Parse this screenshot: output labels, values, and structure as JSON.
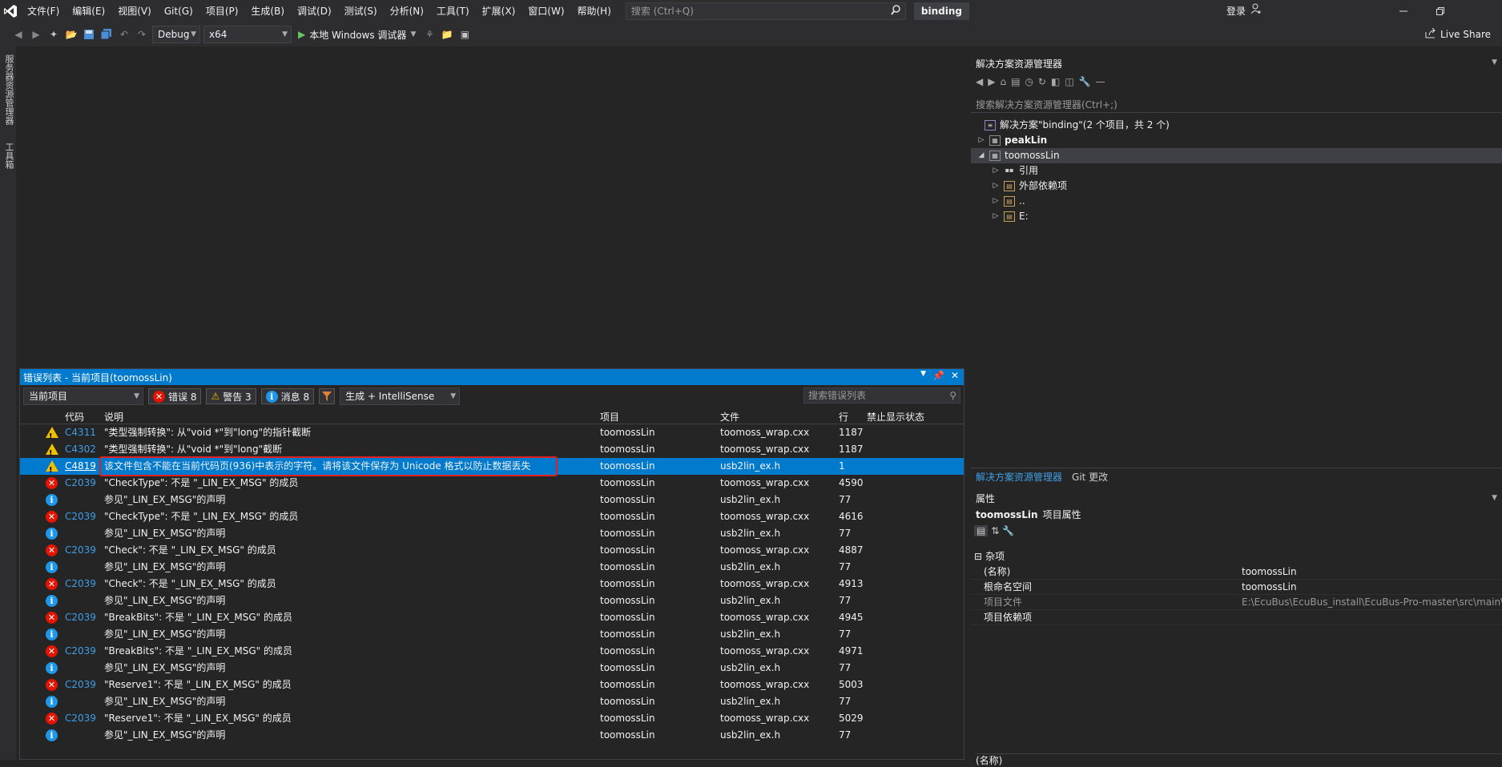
{
  "menubar": {
    "items": [
      "文件(F)",
      "编辑(E)",
      "视图(V)",
      "Git(G)",
      "项目(P)",
      "生成(B)",
      "调试(D)",
      "测试(S)",
      "分析(N)",
      "工具(T)",
      "扩展(X)",
      "窗口(W)",
      "帮助(H)"
    ],
    "search_placeholder": "搜索 (Ctrl+Q)",
    "solution_title": "binding",
    "login": "登录"
  },
  "toolbar": {
    "config": "Debug",
    "platform": "x64",
    "run_label": "本地 Windows 调试器",
    "live_share": "Live Share"
  },
  "left_strip": {
    "tab1": "服务器资源管理器",
    "tab2": "工具箱"
  },
  "error_list": {
    "title": "错误列表 - 当前项目(toomossLin)",
    "scope": "当前项目",
    "errors_label": "错误 8",
    "warnings_label": "警告 3",
    "messages_label": "消息 8",
    "build_filter": "生成 + IntelliSense",
    "search_placeholder": "搜索错误列表",
    "columns": [
      "代码",
      "说明",
      "项目",
      "文件",
      "行",
      "禁止显示状态"
    ],
    "rows": [
      {
        "type": "warning",
        "code": "C4311",
        "desc": "\"类型强制转换\": 从\"void *\"到\"long\"的指针截断",
        "project": "toomossLin",
        "file": "toomoss_wrap.cxx",
        "line": "1187"
      },
      {
        "type": "warning",
        "code": "C4302",
        "desc": "\"类型强制转换\": 从\"void *\"到\"long\"截断",
        "project": "toomossLin",
        "file": "toomoss_wrap.cxx",
        "line": "1187"
      },
      {
        "type": "warning",
        "code": "C4819",
        "desc": "该文件包含不能在当前代码页(936)中表示的字符。请将该文件保存为 Unicode 格式以防止数据丢失",
        "project": "toomossLin",
        "file": "usb2lin_ex.h",
        "line": "1",
        "selected": true
      },
      {
        "type": "error",
        "code": "C2039",
        "desc": "\"CheckType\": 不是 \"_LIN_EX_MSG\" 的成员",
        "project": "toomossLin",
        "file": "toomoss_wrap.cxx",
        "line": "4590"
      },
      {
        "type": "info",
        "code": "",
        "desc": "参见\"_LIN_EX_MSG\"的声明",
        "project": "toomossLin",
        "file": "usb2lin_ex.h",
        "line": "77"
      },
      {
        "type": "error",
        "code": "C2039",
        "desc": "\"CheckType\": 不是 \"_LIN_EX_MSG\" 的成员",
        "project": "toomossLin",
        "file": "toomoss_wrap.cxx",
        "line": "4616"
      },
      {
        "type": "info",
        "code": "",
        "desc": "参见\"_LIN_EX_MSG\"的声明",
        "project": "toomossLin",
        "file": "usb2lin_ex.h",
        "line": "77"
      },
      {
        "type": "error",
        "code": "C2039",
        "desc": "\"Check\": 不是 \"_LIN_EX_MSG\" 的成员",
        "project": "toomossLin",
        "file": "toomoss_wrap.cxx",
        "line": "4887"
      },
      {
        "type": "info",
        "code": "",
        "desc": "参见\"_LIN_EX_MSG\"的声明",
        "project": "toomossLin",
        "file": "usb2lin_ex.h",
        "line": "77"
      },
      {
        "type": "error",
        "code": "C2039",
        "desc": "\"Check\": 不是 \"_LIN_EX_MSG\" 的成员",
        "project": "toomossLin",
        "file": "toomoss_wrap.cxx",
        "line": "4913"
      },
      {
        "type": "info",
        "code": "",
        "desc": "参见\"_LIN_EX_MSG\"的声明",
        "project": "toomossLin",
        "file": "usb2lin_ex.h",
        "line": "77"
      },
      {
        "type": "error",
        "code": "C2039",
        "desc": "\"BreakBits\": 不是 \"_LIN_EX_MSG\" 的成员",
        "project": "toomossLin",
        "file": "toomoss_wrap.cxx",
        "line": "4945"
      },
      {
        "type": "info",
        "code": "",
        "desc": "参见\"_LIN_EX_MSG\"的声明",
        "project": "toomossLin",
        "file": "usb2lin_ex.h",
        "line": "77"
      },
      {
        "type": "error",
        "code": "C2039",
        "desc": "\"BreakBits\": 不是 \"_LIN_EX_MSG\" 的成员",
        "project": "toomossLin",
        "file": "toomoss_wrap.cxx",
        "line": "4971"
      },
      {
        "type": "info",
        "code": "",
        "desc": "参见\"_LIN_EX_MSG\"的声明",
        "project": "toomossLin",
        "file": "usb2lin_ex.h",
        "line": "77"
      },
      {
        "type": "error",
        "code": "C2039",
        "desc": "\"Reserve1\": 不是 \"_LIN_EX_MSG\" 的成员",
        "project": "toomossLin",
        "file": "toomoss_wrap.cxx",
        "line": "5003"
      },
      {
        "type": "info",
        "code": "",
        "desc": "参见\"_LIN_EX_MSG\"的声明",
        "project": "toomossLin",
        "file": "usb2lin_ex.h",
        "line": "77"
      },
      {
        "type": "error",
        "code": "C2039",
        "desc": "\"Reserve1\": 不是 \"_LIN_EX_MSG\" 的成员",
        "project": "toomossLin",
        "file": "toomoss_wrap.cxx",
        "line": "5029"
      },
      {
        "type": "info",
        "code": "",
        "desc": "参见\"_LIN_EX_MSG\"的声明",
        "project": "toomossLin",
        "file": "usb2lin_ex.h",
        "line": "77"
      }
    ]
  },
  "solution_explorer": {
    "title": "解决方案资源管理器",
    "search_placeholder": "搜索解决方案资源管理器(Ctrl+;)",
    "solution_label": "解决方案\"binding\"(2 个项目，共 2 个)",
    "items": [
      {
        "label": "peakLin",
        "bold": true
      },
      {
        "label": "toomossLin",
        "selected": true
      },
      {
        "label": "引用"
      },
      {
        "label": "外部依赖项"
      },
      {
        "label": ".."
      },
      {
        "label": "E:"
      }
    ],
    "tabs": [
      "解决方案资源管理器",
      "Git 更改"
    ]
  },
  "properties": {
    "title": "属性",
    "object_name": "toomossLin",
    "object_type": "项目属性",
    "category": "杂项",
    "rows": [
      {
        "name": "(名称)",
        "value": "toomossLin"
      },
      {
        "name": "根命名空间",
        "value": "toomossLin"
      },
      {
        "name": "项目文件",
        "value": "E:\\EcuBus\\EcuBus_install\\EcuBus-Pro-master\\src\\main\\d"
      },
      {
        "name": "项目依赖项",
        "value": ""
      }
    ],
    "footer_name": "(名称)"
  }
}
